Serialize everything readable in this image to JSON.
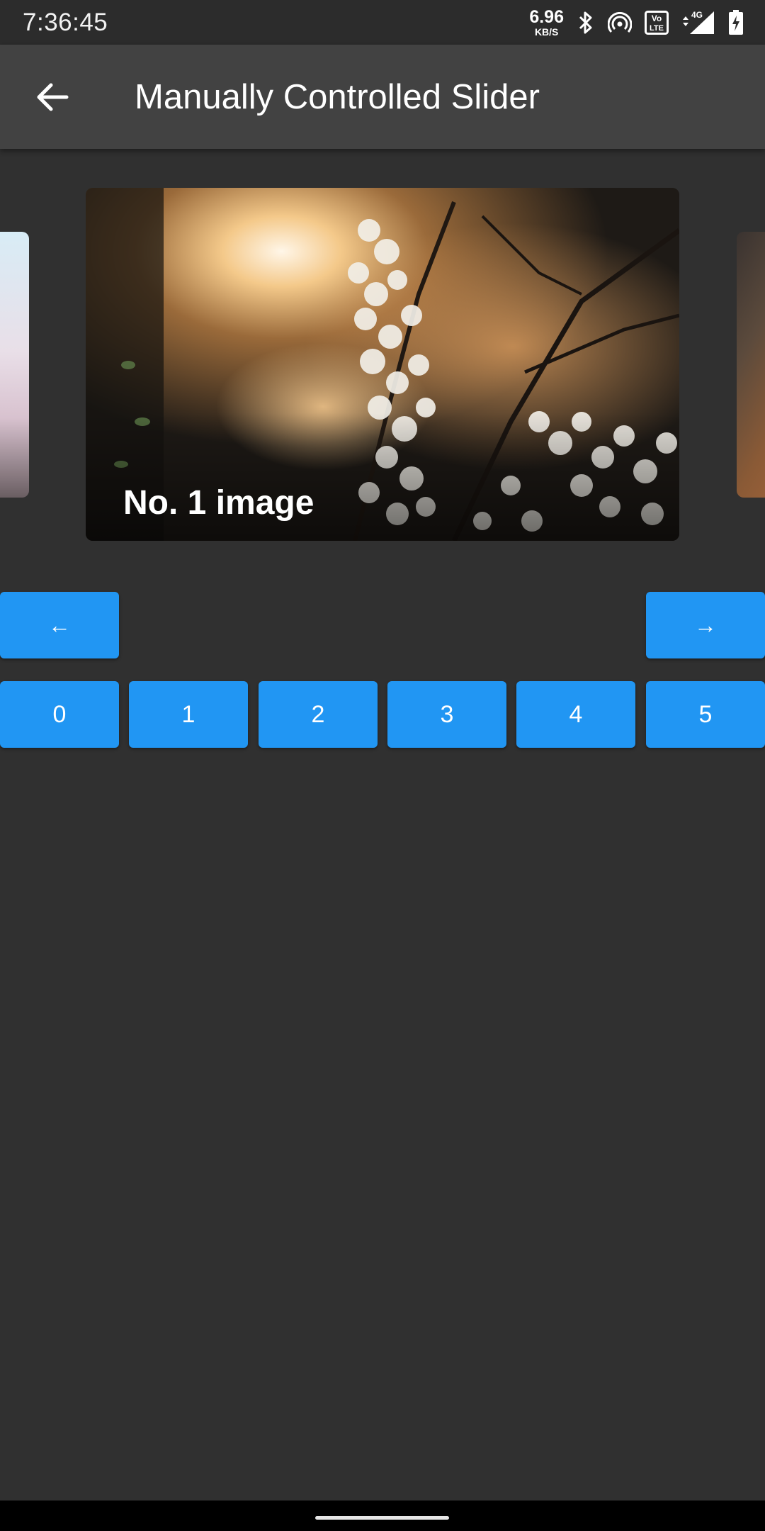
{
  "status_bar": {
    "time": "7:36:45",
    "net_speed_value": "6.96",
    "net_speed_unit": "KB/S",
    "icons": [
      "bluetooth-icon",
      "hotspot-icon",
      "volte-icon",
      "signal-4g-icon",
      "battery-charging-icon"
    ],
    "volte_top": "Vo",
    "volte_bottom": "LTE",
    "network_type": "4G"
  },
  "app_bar": {
    "back_icon": "arrow-back-icon",
    "title": "Manually Controlled Slider"
  },
  "carousel": {
    "current_caption": "No. 1 image",
    "current_index": 1
  },
  "controls": {
    "prev_label": "←",
    "next_label": "→",
    "page_buttons": [
      "0",
      "1",
      "2",
      "3",
      "4",
      "5"
    ]
  },
  "colors": {
    "background": "#303030",
    "app_bar": "#424242",
    "accent": "#2196f3"
  }
}
